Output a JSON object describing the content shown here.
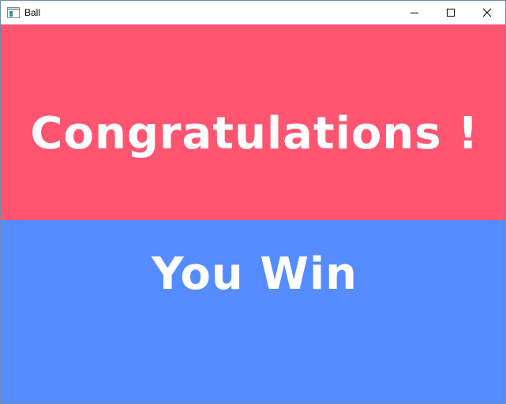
{
  "window": {
    "title": "Ball",
    "app_icon": "app-window-icon",
    "buttons": {
      "minimize_icon": "minimize-icon",
      "maximize_icon": "maximize-icon",
      "close_icon": "close-icon"
    }
  },
  "game": {
    "headline": "Congratulations !",
    "subline": "You Win"
  },
  "colors": {
    "top_panel": "#ff5571",
    "bottom_panel": "#558cff",
    "text": "#ffffff"
  }
}
